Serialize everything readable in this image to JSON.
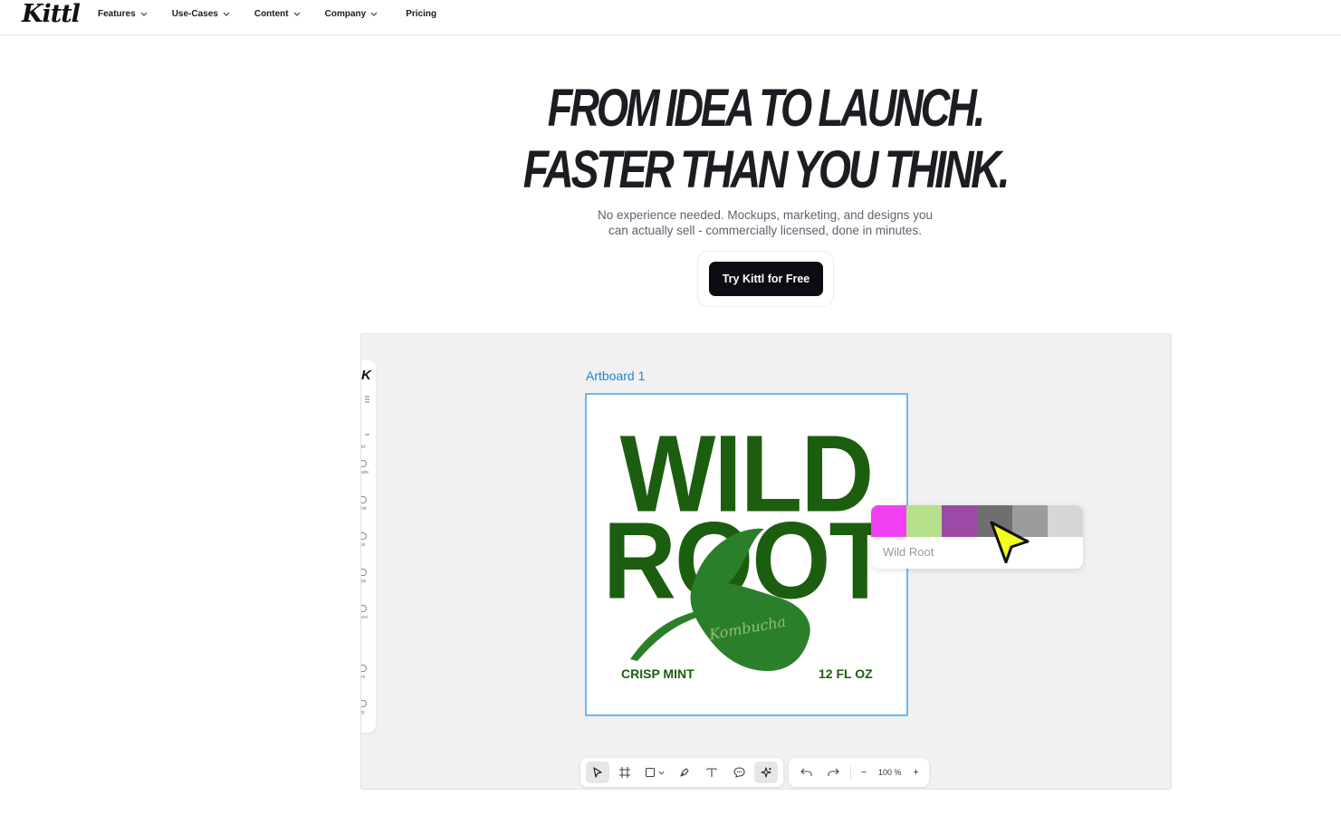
{
  "brand": {
    "logo": "Kittl"
  },
  "nav": {
    "items": [
      {
        "label": "Features",
        "has_dropdown": true
      },
      {
        "label": "Use-Cases",
        "has_dropdown": true
      },
      {
        "label": "Content",
        "has_dropdown": true
      },
      {
        "label": "Company",
        "has_dropdown": true
      },
      {
        "label": "Pricing",
        "has_dropdown": false
      }
    ]
  },
  "hero": {
    "headline_line1": "FROM IDEA TO LAUNCH.",
    "headline_line2": "FASTER THAN YOU THINK.",
    "subtitle_line1": "No experience needed. Mockups, marketing, and designs you",
    "subtitle_line2": "can actually sell - commercially licensed, done in minutes.",
    "cta_label": "Try Kittl for Free"
  },
  "editor": {
    "artboard_title": "Artboard 1",
    "design": {
      "line1": "WILD",
      "line2": "ROOT",
      "script_text": "Kombucha",
      "left_caption": "CRISP MINT",
      "right_caption": "12 FL OZ",
      "primary_color": "#1c5e0f",
      "leaf_color": "#2b7f2a",
      "script_color": "#8fbf73"
    },
    "side_labels": [
      "",
      "",
      "ld",
      "ads",
      "nd",
      "at",
      "ps",
      "ers",
      "rn",
      "lp"
    ],
    "color_popup": {
      "swatches": [
        "#f140f4",
        "#b5e18a",
        "#9c4aa6",
        "#6f6f6f",
        "#9c9c9c",
        "#d6d6d6"
      ],
      "name": "Wild Root"
    },
    "toolbar": {
      "tools": [
        "select-icon",
        "frame-icon",
        "shape-icon",
        "pen-icon",
        "text-icon",
        "comment-icon",
        "ai-sparkle-icon"
      ],
      "undo": "undo-icon",
      "redo": "redo-icon",
      "zoom_minus": "−",
      "zoom_level": "100 %",
      "zoom_plus": "+"
    }
  }
}
